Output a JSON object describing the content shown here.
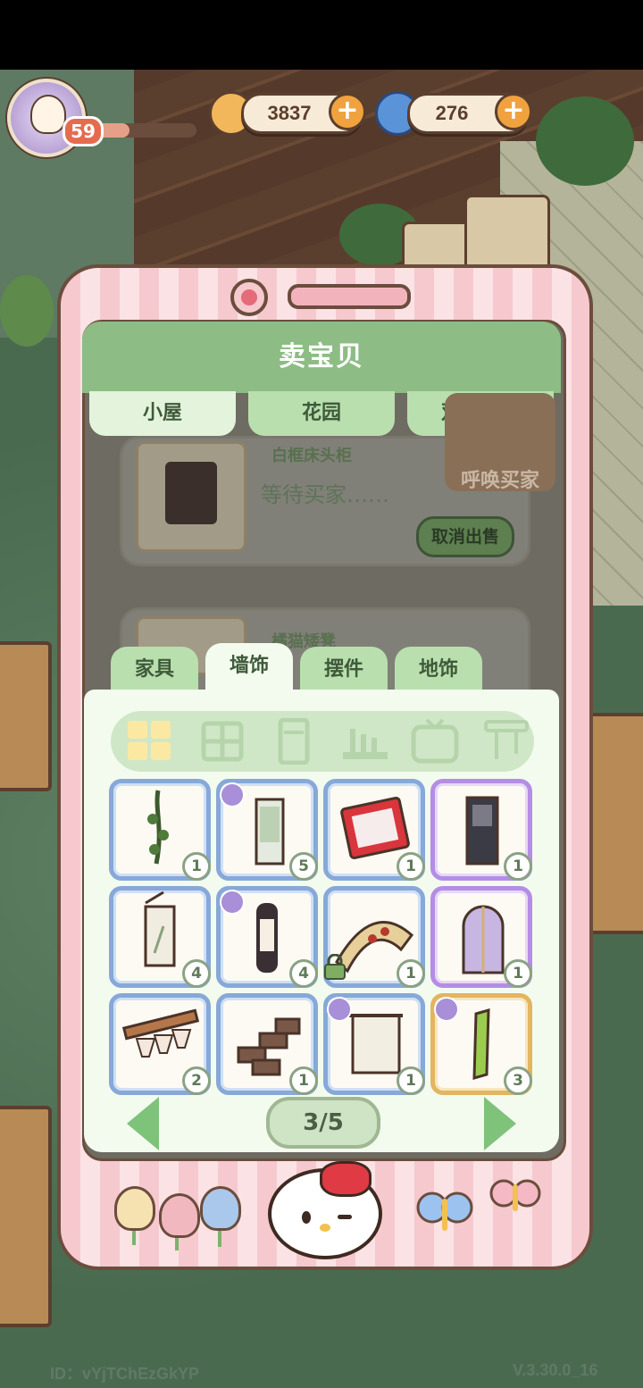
{
  "hud": {
    "level": "59",
    "xp_fraction": 0.35,
    "coins": "3837",
    "gems": "276",
    "coin_icon": "coin-icon",
    "gem_icon": "swirl-gem-icon"
  },
  "sell": {
    "title": "卖宝贝",
    "tabs": [
      {
        "label": "小屋",
        "active": true
      },
      {
        "label": "花园",
        "active": false
      },
      {
        "label": "双人空间",
        "active": false
      }
    ],
    "listings": [
      {
        "name": "白框床头柜",
        "status": "等待买家……",
        "cancel_label": "取消出售"
      },
      {
        "name": "橘猫矮凳"
      }
    ],
    "summon_label": "呼唤买家"
  },
  "inventory": {
    "category_tabs": [
      {
        "label": "家具",
        "active": false
      },
      {
        "label": "墙饰",
        "active": true
      },
      {
        "label": "摆件",
        "active": false
      },
      {
        "label": "地饰",
        "active": false
      }
    ],
    "sub_icons": [
      "grid-all-icon",
      "window-icon",
      "door-icon",
      "shelf-icon",
      "tv-icon",
      "hook-icon"
    ],
    "items": [
      {
        "art": "hanging-vine",
        "count": "1",
        "rarity": "blue",
        "tag": false
      },
      {
        "art": "scroll-painting",
        "count": "5",
        "rarity": "blue",
        "tag": true
      },
      {
        "art": "kitty-frame",
        "count": "1",
        "rarity": "blue",
        "tag": false
      },
      {
        "art": "dark-window",
        "count": "1",
        "rarity": "purple",
        "tag": false
      },
      {
        "art": "wall-scroll",
        "count": "4",
        "rarity": "blue",
        "tag": false
      },
      {
        "art": "wall-lamp",
        "count": "4",
        "rarity": "blue",
        "tag": true
      },
      {
        "art": "fan-screen",
        "count": "1",
        "rarity": "blue",
        "tag": false,
        "locked": true
      },
      {
        "art": "arched-window",
        "count": "1",
        "rarity": "purple",
        "tag": false
      },
      {
        "art": "glass-rack",
        "count": "2",
        "rarity": "blue",
        "tag": false
      },
      {
        "art": "brick-patch",
        "count": "1",
        "rarity": "blue",
        "tag": false
      },
      {
        "art": "blank-scroll",
        "count": "1",
        "rarity": "blue",
        "tag": true
      },
      {
        "art": "green-panel",
        "count": "3",
        "rarity": "gold",
        "tag": true
      }
    ],
    "pager": "3/5"
  },
  "footer": {
    "id": "ID：vYjTChEzGkYP",
    "version": "V.3.30.0_16"
  },
  "colors": {
    "accent_green": "#8dbd84",
    "phone_pink": "#f6c9cf",
    "frame_brown": "#6b4d3d"
  }
}
